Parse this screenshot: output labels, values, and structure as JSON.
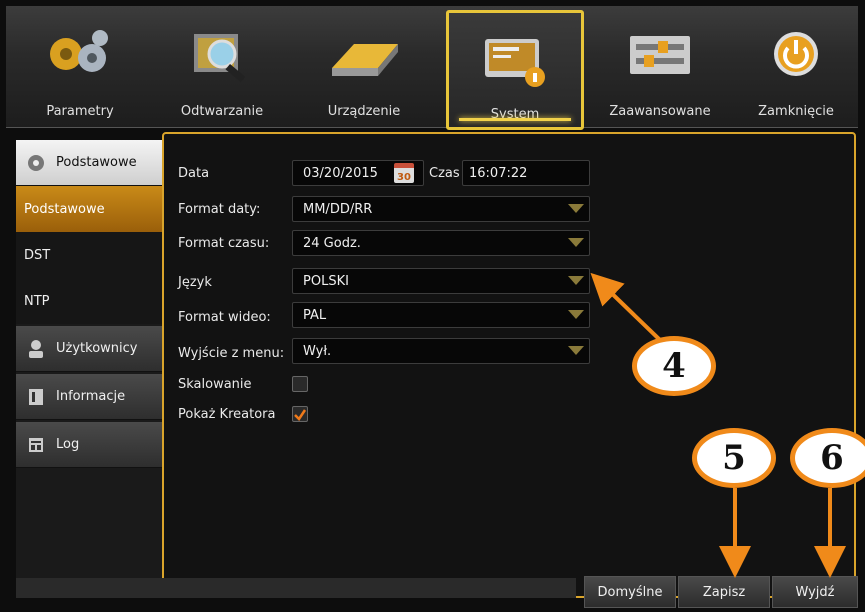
{
  "top_menu": [
    {
      "label": "Parametry",
      "icon": "gears-icon"
    },
    {
      "label": "Odtwarzanie",
      "icon": "film-magnifier-icon"
    },
    {
      "label": "Urządzenie",
      "icon": "hard-drive-icon"
    },
    {
      "label": "System",
      "icon": "monitor-info-icon",
      "active": true
    },
    {
      "label": "Zaawansowane",
      "icon": "sliders-icon"
    },
    {
      "label": "Zamknięcie",
      "icon": "power-icon"
    }
  ],
  "sidebar": {
    "section_basic": "Podstawowe",
    "items": [
      "Podstawowe",
      "DST",
      "NTP"
    ],
    "section_users": "Użytkownicy",
    "section_info": "Informacje",
    "section_log": "Log"
  },
  "form": {
    "date_label": "Data",
    "date_value": "03/20/2015",
    "calendar_day": "30",
    "time_label": "Czas",
    "time_value": "16:07:22",
    "date_format_label": "Format daty:",
    "date_format_value": "MM/DD/RR",
    "time_format_label": "Format czasu:",
    "time_format_value": "24 Godz.",
    "language_label": "Język",
    "language_value": "POLSKI",
    "video_format_label": "Format wideo:",
    "video_format_value": "PAL",
    "menu_exit_label": "Wyjście z menu:",
    "menu_exit_value": "Wył.",
    "scaling_label": "Skalowanie",
    "scaling_checked": false,
    "wizard_label": "Pokaż Kreatora",
    "wizard_checked": true
  },
  "buttons": {
    "default": "Domyślne",
    "save": "Zapisz",
    "exit": "Wyjdź"
  },
  "callouts": [
    "4",
    "5",
    "6"
  ],
  "colors": {
    "accent": "#d9a42b",
    "callout": "#f08a1a",
    "active_tab": "#e8c63a"
  }
}
